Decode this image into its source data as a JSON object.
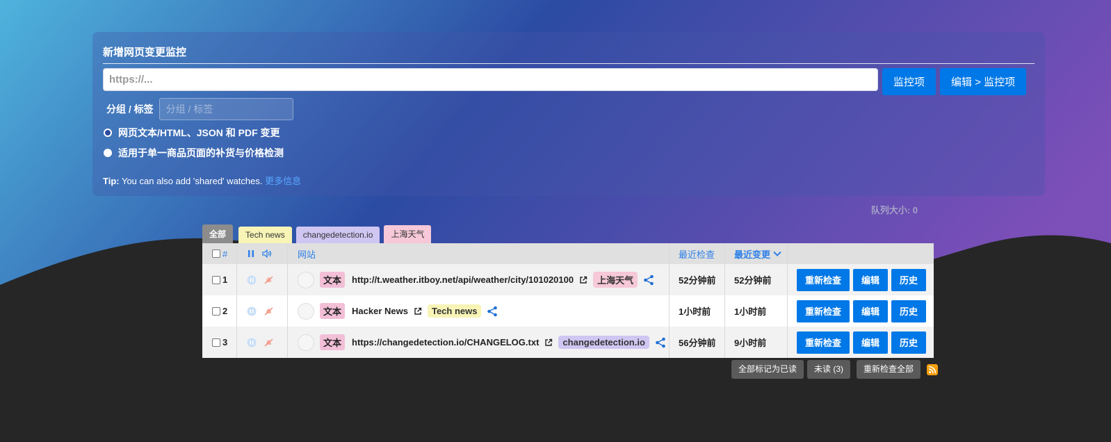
{
  "panel": {
    "title": "新增网页变更监控",
    "url_placeholder": "https://...",
    "watch_button": "监控项",
    "edit_watch_button": "编辑 > 监控项",
    "tag_label": "分组 / 标签",
    "tag_placeholder": "分组 / 标签",
    "radio_options": [
      {
        "label": "网页文本/HTML、JSON 和 PDF 变更",
        "selected": true
      },
      {
        "label": "适用于单一商品页面的补货与价格检测",
        "selected": false
      }
    ],
    "tip_prefix": "Tip:",
    "tip_text": " You can also add 'shared' watches. ",
    "tip_link": "更多信息"
  },
  "queue_size": "队列大小: 0",
  "tabs": [
    "全部",
    "Tech news",
    "changedetection.io",
    "上海天气"
  ],
  "table": {
    "headers": {
      "number": "#",
      "website": "网站",
      "last_checked": "最近检查",
      "last_changed": "最近变更"
    },
    "rows": [
      {
        "num": "1",
        "type": "文本",
        "url": "http://t.weather.itboy.net/api/weather/city/101020100",
        "tag": "上海天气",
        "checked": "52分钟前",
        "changed": "52分钟前"
      },
      {
        "num": "2",
        "type": "文本",
        "url": "Hacker News",
        "tag": "Tech news",
        "checked": "1小时前",
        "changed": "1小时前"
      },
      {
        "num": "3",
        "type": "文本",
        "url": "https://changedetection.io/CHANGELOG.txt",
        "tag": "changedetection.io",
        "checked": "56分钟前",
        "changed": "9小时前"
      }
    ],
    "actions": {
      "recheck": "重新检查",
      "edit": "编辑",
      "history": "历史"
    }
  },
  "footer": {
    "mark_all_read": "全部标记为已读",
    "unread": "未读 (3)",
    "recheck_all": "重新检查全部"
  },
  "colors": {
    "primary_blue": "#0078e7",
    "tag_shanghai": "#f6c8d8",
    "tag_tech": "#f7f4b6",
    "tag_cd": "#cfc6f2",
    "type_badge": "#f2bfd7"
  }
}
